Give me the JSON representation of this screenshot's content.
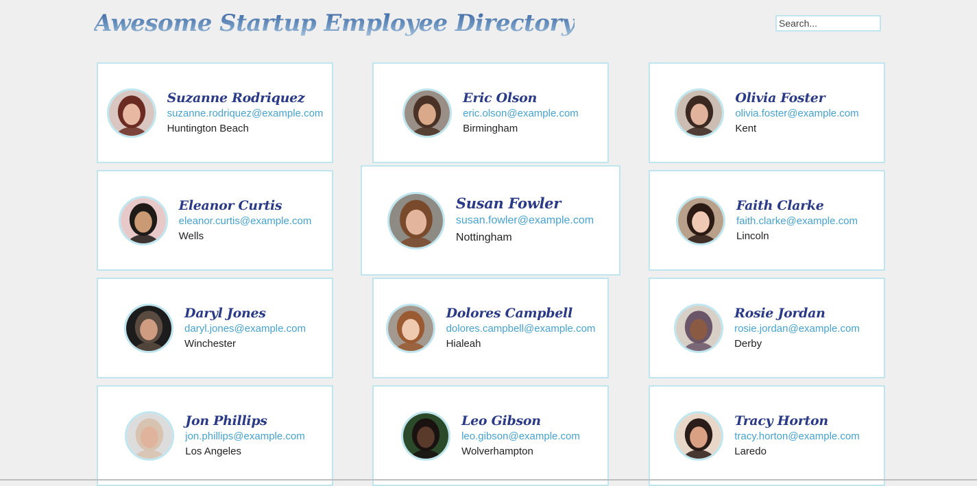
{
  "header": {
    "title": "Awesome Startup Employee Directory",
    "search_placeholder": "Search..."
  },
  "colors": {
    "background": "#efefef",
    "card_border": "#bfe6ef",
    "name": "#2a3a86",
    "email": "#45a3d1",
    "city": "#222222"
  },
  "employees": [
    {
      "name": "Suzanne Rodriquez",
      "email": "suzanne.rodriquez@example.com",
      "city": "Huntington Beach",
      "skin": "#e8b8a2",
      "hair": "#6b2b22",
      "bg": "#d9c6c0"
    },
    {
      "name": "Eric Olson",
      "email": "eric.olson@example.com",
      "city": "Birmingham",
      "skin": "#d9a98a",
      "hair": "#4a3326",
      "bg": "#9a8f86"
    },
    {
      "name": "Olivia Foster",
      "email": "olivia.foster@example.com",
      "city": "Kent",
      "skin": "#e2b39c",
      "hair": "#3b2820",
      "bg": "#cbbdb2"
    },
    {
      "name": "Eleanor Curtis",
      "email": "eleanor.curtis@example.com",
      "city": "Wells",
      "skin": "#c99a74",
      "hair": "#1e1a18",
      "bg": "#e7c9c9"
    },
    {
      "name": "Susan Fowler",
      "email": "susan.fowler@example.com",
      "city": "Nottingham",
      "skin": "#e3b59d",
      "hair": "#7a4a2c",
      "bg": "#8e8a84"
    },
    {
      "name": "Faith Clarke",
      "email": "faith.clarke@example.com",
      "city": "Lincoln",
      "skin": "#f0c9b4",
      "hair": "#2c1a15",
      "bg": "#b8a08a"
    },
    {
      "name": "Daryl Jones",
      "email": "daryl.jones@example.com",
      "city": "Winchester",
      "skin": "#cf9c82",
      "hair": "#5a4b40",
      "bg": "#1c1c1c"
    },
    {
      "name": "Dolores Campbell",
      "email": "dolores.campbell@example.com",
      "city": "Hialeah",
      "skin": "#efc9b0",
      "hair": "#9a5a32",
      "bg": "#a3998f"
    },
    {
      "name": "Rosie Jordan",
      "email": "rosie.jordan@example.com",
      "city": "Derby",
      "skin": "#8a5a42",
      "hair": "#6a5668",
      "bg": "#d8cfc6"
    },
    {
      "name": "Jon Phillips",
      "email": "jon.phillips@example.com",
      "city": "Los Angeles",
      "skin": "#e0b49c",
      "hair": "#d8c2b0",
      "bg": "#dcdcdc"
    },
    {
      "name": "Leo Gibson",
      "email": "leo.gibson@example.com",
      "city": "Wolverhampton",
      "skin": "#5a3a2a",
      "hair": "#1a1210",
      "bg": "#2a4a2a"
    },
    {
      "name": "Tracy Horton",
      "email": "tracy.horton@example.com",
      "city": "Laredo",
      "skin": "#d9a084",
      "hair": "#2a1c18",
      "bg": "#e8d6c8"
    }
  ]
}
